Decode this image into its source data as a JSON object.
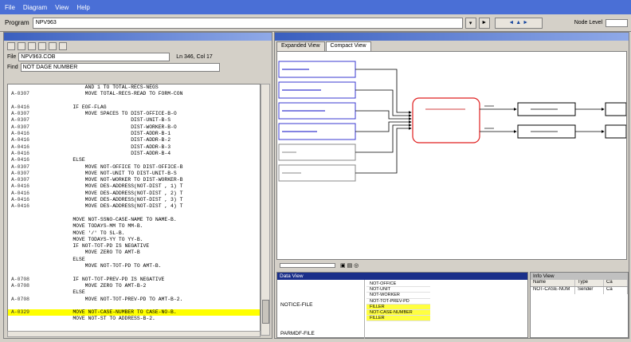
{
  "menu": [
    "File",
    "Diagram",
    "View",
    "Help"
  ],
  "toolbar": {
    "program_label": "Program",
    "program_value": "NPV963",
    "mode_label": "Node Level"
  },
  "left": {
    "pane_title": "",
    "file_label": "File",
    "file_value": "NPV963.COB",
    "position": "Ln 346, Col 17",
    "find_label": "Find",
    "find_value": "NOT DAGE NUMBER",
    "code_lines": [
      {
        "num": "",
        "text": "        AND 1 TO TOTAL-RECS-NEGS",
        "hl": false
      },
      {
        "num": "A-0307",
        "text": "        MOVE TOTAL-RECS-READ TO FORM-CON",
        "hl": false
      },
      {
        "num": "",
        "text": "",
        "hl": false
      },
      {
        "num": "A-0416",
        "text": "    IF EOF-FLAG",
        "hl": false
      },
      {
        "num": "A-0307",
        "text": "        MOVE SPACES TO DIST-OFFICE-B-O",
        "hl": false
      },
      {
        "num": "A-0307",
        "text": "                       DIST-UNIT-B-S",
        "hl": false
      },
      {
        "num": "A-0307",
        "text": "                       DIST-WORKER-B-O",
        "hl": false
      },
      {
        "num": "A-0416",
        "text": "                       DIST-ADDR-B-1",
        "hl": false
      },
      {
        "num": "A-0416",
        "text": "                       DIST-ADDR-B-2",
        "hl": false
      },
      {
        "num": "A-0416",
        "text": "                       DIST-ADDR-B-3",
        "hl": false
      },
      {
        "num": "A-0416",
        "text": "                       DIST-ADDR-B-4",
        "hl": false
      },
      {
        "num": "A-0416",
        "text": "    ELSE",
        "hl": false
      },
      {
        "num": "A-0307",
        "text": "        MOVE NOT-OFFICE TO DIST-OFFICE-B",
        "hl": false
      },
      {
        "num": "A-0307",
        "text": "        MOVE NOT-UNIT TO DIST-UNIT-B-S",
        "hl": false
      },
      {
        "num": "A-0307",
        "text": "        MOVE NOT-WORKER TO DIST-WORKER-B",
        "hl": false
      },
      {
        "num": "A-0416",
        "text": "        MOVE DES-ADDRESS(NOT-DIST , 1) T",
        "hl": false
      },
      {
        "num": "A-0416",
        "text": "        MOVE DES-ADDRESS(NOT-DIST , 2) T",
        "hl": false
      },
      {
        "num": "A-0416",
        "text": "        MOVE DES-ADDRESS(NOT-DIST , 3) T",
        "hl": false
      },
      {
        "num": "A-0416",
        "text": "        MOVE DES-ADDRESS(NOT-DIST , 4) T",
        "hl": false
      },
      {
        "num": "",
        "text": "",
        "hl": false
      },
      {
        "num": "",
        "text": "    MOVE NOT-SSNO-CASE-NAME TO NAME-B.",
        "hl": false
      },
      {
        "num": "",
        "text": "    MOVE TODAYS-MM TO MM-B.",
        "hl": false
      },
      {
        "num": "",
        "text": "    MOVE '/' TO SL-B.",
        "hl": false
      },
      {
        "num": "",
        "text": "    MOVE TODAYS-YY TO YY-B.",
        "hl": false
      },
      {
        "num": "",
        "text": "    IF NOT-TOT-PD IS NEGATIVE",
        "hl": false
      },
      {
        "num": "",
        "text": "        MOVE ZERO TO AMT-B",
        "hl": false
      },
      {
        "num": "",
        "text": "    ELSE",
        "hl": false
      },
      {
        "num": "",
        "text": "        MOVE NOT-TOT-PD TO AMT-B.",
        "hl": false
      },
      {
        "num": "",
        "text": "",
        "hl": false
      },
      {
        "num": "A-0708",
        "text": "    IF NOT-TOT-PREV-PD IS NEGATIVE",
        "hl": false
      },
      {
        "num": "A-0708",
        "text": "        MOVE ZERO TO AMT-B-2",
        "hl": false
      },
      {
        "num": "",
        "text": "    ELSE",
        "hl": false
      },
      {
        "num": "A-0708",
        "text": "        MOVE NOT-TOT-PREV-PD TO AMT-B-2.",
        "hl": false
      },
      {
        "num": "",
        "text": "",
        "hl": false
      },
      {
        "num": "A-0329",
        "text": "    MOVE NOT-CASE-NUMBER TO CASE-NO-B.",
        "hl": true
      },
      {
        "num": "",
        "text": "    MOVE NOT-ST TO ADDRESS-B-2.",
        "hl": false
      }
    ]
  },
  "right": {
    "tabs": [
      "Expanded View",
      "Compact View"
    ],
    "active_tab": "Compact View",
    "data_panel_title": "Data View",
    "notice_label": "NOTICE-FILE",
    "parameter_label": "PARMDF-FILE",
    "data_items": [
      {
        "label": "NOT-OFFICE",
        "yellow": false
      },
      {
        "label": "NOT-UNIT",
        "yellow": false
      },
      {
        "label": "NOT-WORKER",
        "yellow": false
      },
      {
        "label": "NOT-TOT-PREV-PD",
        "yellow": false
      },
      {
        "label": "FILLER",
        "yellow": true
      },
      {
        "label": "NOT-CASE-NUMBER",
        "yellow": true
      },
      {
        "label": "FILLER",
        "yellow": true
      }
    ],
    "info_title": "Info View",
    "info_headers": [
      "Name",
      "Type",
      "Ca"
    ],
    "info_rows": [
      [
        "NOT-CASE-NUM",
        "Sender",
        "Ca"
      ]
    ]
  }
}
